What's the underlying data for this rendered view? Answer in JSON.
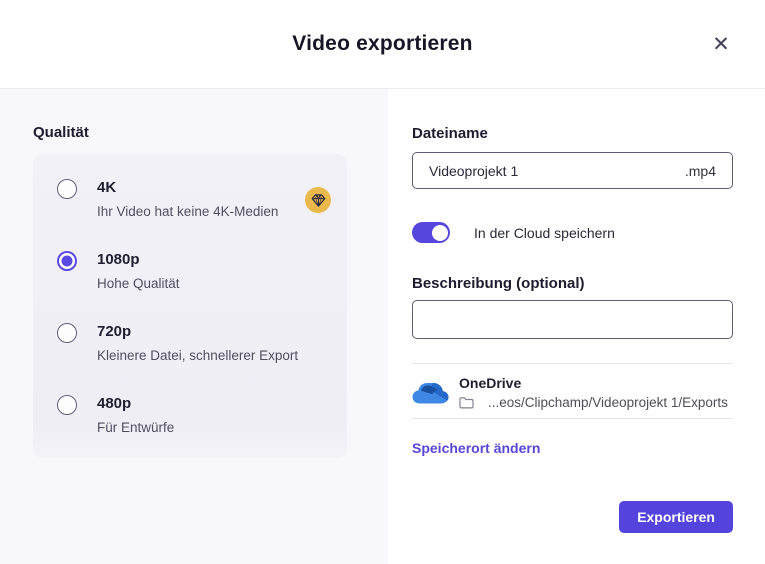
{
  "dialog": {
    "title": "Video exportieren",
    "close_glyph": "✕"
  },
  "quality": {
    "heading": "Qualität",
    "options": [
      {
        "label": "4K",
        "description": "Ihr Video hat keine 4K-Medien",
        "selected": false,
        "premium": true
      },
      {
        "label": "1080p",
        "description": "Hohe Qualität",
        "selected": true,
        "premium": false
      },
      {
        "label": "720p",
        "description": "Kleinere Datei, schnellerer Export",
        "selected": false,
        "premium": false
      },
      {
        "label": "480p",
        "description": "Für Entwürfe",
        "selected": false,
        "premium": false
      }
    ]
  },
  "filename": {
    "label": "Dateiname",
    "value": "Videoprojekt 1",
    "extension": ".mp4"
  },
  "cloud_toggle": {
    "label": "In der Cloud speichern",
    "on": true
  },
  "description": {
    "label": "Beschreibung (optional)",
    "value": ""
  },
  "storage": {
    "provider": "OneDrive",
    "path": "...eos/Clipchamp/Videoprojekt 1/Exports",
    "change_link": "Speicherort ändern"
  },
  "export_button": {
    "label": "Exportieren"
  },
  "colors": {
    "accent": "#5646de",
    "link": "#5846d6",
    "premium_badge": "#eab94b",
    "left_panel_bg": "#f8f8fc",
    "card_bg": "#f1f0f6"
  }
}
